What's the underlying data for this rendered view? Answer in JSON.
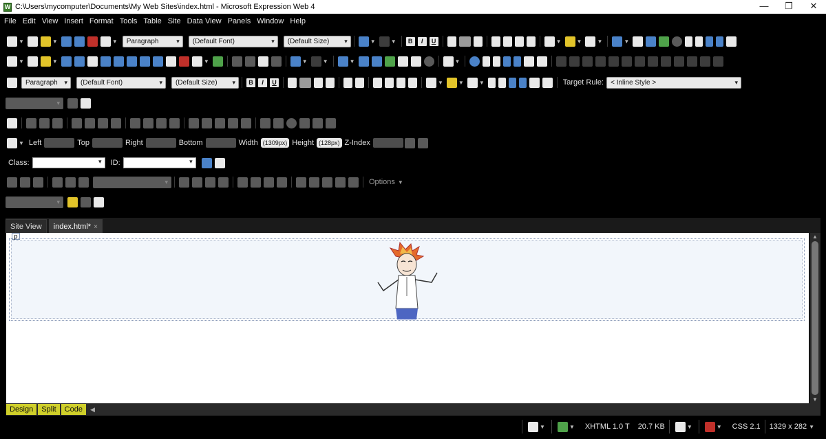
{
  "window": {
    "title": "C:\\Users\\mycomputer\\Documents\\My Web Sites\\index.html - Microsoft Expression Web 4",
    "minimize": "—",
    "maximize": "❐",
    "close": "✕"
  },
  "menu": [
    "File",
    "Edit",
    "View",
    "Insert",
    "Format",
    "Tools",
    "Table",
    "Site",
    "Data View",
    "Panels",
    "Window",
    "Help"
  ],
  "toolbar1": {
    "style": "Paragraph",
    "font": "(Default Font)",
    "size": "(Default Size)",
    "bold": "B",
    "italic": "I",
    "underline": "U"
  },
  "toolbar3": {
    "style": "Paragraph",
    "font": "(Default Font)",
    "size": "(Default Size)",
    "bold": "B",
    "italic": "I",
    "underline": "U",
    "target_rule_label": "Target Rule:",
    "target_rule_value": "< Inline Style >"
  },
  "positioning": {
    "left_label": "Left",
    "top_label": "Top",
    "right_label": "Right",
    "bottom_label": "Bottom",
    "width_label": "Width",
    "width_value": "(1309px)",
    "height_label": "Height",
    "height_value": "(128px)",
    "zindex_label": "Z-Index"
  },
  "class_id": {
    "class_label": "Class:",
    "id_label": "ID:"
  },
  "code_toolbar": {
    "options_label": "Options"
  },
  "tabs": [
    {
      "label": "Site View"
    },
    {
      "label": "index.html*",
      "close": "×"
    }
  ],
  "design": {
    "tag_label": "p"
  },
  "view_modes": [
    "Design",
    "Split",
    "Code"
  ],
  "status": {
    "doctype": "XHTML 1.0 T",
    "size": "20.7 KB",
    "css": "CSS 2.1",
    "dimensions": "1329 x 282"
  },
  "colors": {
    "chrome": "#000000",
    "highlight": "#cfcf2a",
    "paragraph_bg": "#f2f6fb"
  }
}
